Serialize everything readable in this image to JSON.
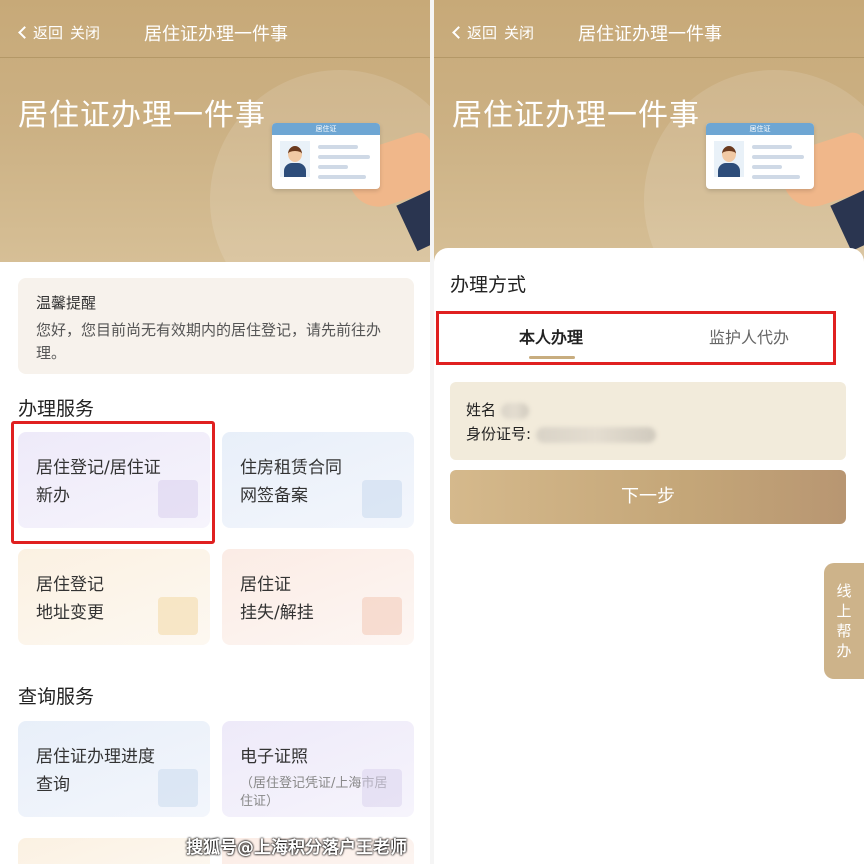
{
  "left": {
    "nav": {
      "back": "返回",
      "close": "关闭",
      "title": "居住证办理一件事"
    },
    "hero_title": "居住证办理一件事",
    "idcard_label": "居住证",
    "notice": {
      "title": "温馨提醒",
      "text": "您好，您目前尚无有效期内的居住登记，请先前往办理。"
    },
    "service_title": "办理服务",
    "services": [
      {
        "line1": "居住登记/居住证",
        "line2": "新办"
      },
      {
        "line1": "住房租赁合同",
        "line2": "网签备案"
      },
      {
        "line1": "居住登记",
        "line2": "地址变更"
      },
      {
        "line1": "居住证",
        "line2": "挂失/解挂"
      }
    ],
    "query_title": "查询服务",
    "queries": [
      {
        "line1": "居住证办理进度",
        "line2": "查询"
      },
      {
        "line1": "电子证照",
        "sub": "（居住登记凭证/上海市居住证）"
      }
    ]
  },
  "right": {
    "nav": {
      "back": "返回",
      "close": "关闭",
      "title": "居住证办理一件事"
    },
    "hero_title": "居住证办理一件事",
    "idcard_label": "居住证",
    "method_title": "办理方式",
    "tabs": {
      "self": "本人办理",
      "guardian": "监护人代办"
    },
    "info": {
      "name_label": "姓名",
      "id_label": "身份证号:"
    },
    "next_button": "下一步",
    "help": "线上帮办"
  },
  "watermark": "搜狐号@上海积分落户王老师",
  "colors": {
    "gold": "#c8ad7f",
    "highlight": "#e02020",
    "info_bg": "#f2ebdb"
  }
}
